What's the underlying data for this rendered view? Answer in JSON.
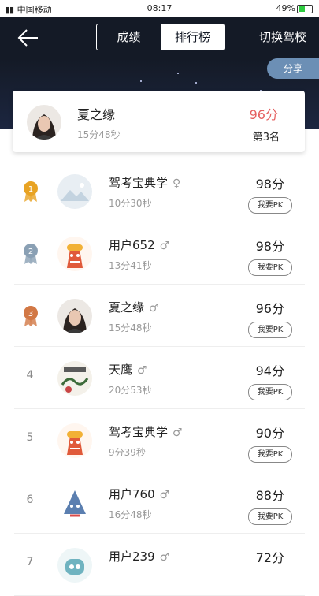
{
  "status_bar": {
    "left": "中国移动",
    "time": "08:17",
    "battery": "49%",
    "battery_level": 0.49
  },
  "header": {
    "tabs": [
      {
        "label": "成绩",
        "active": false
      },
      {
        "label": "排行榜",
        "active": true
      }
    ],
    "switch_label": "切换驾校"
  },
  "share_label": "分享",
  "me": {
    "name": "夏之缘",
    "time": "15分48秒",
    "score": "96分",
    "rank": "第3名"
  },
  "ranking": [
    {
      "rank": "1",
      "medal": "gold",
      "name": "驾考宝典学",
      "gender": "♀",
      "time": "10分30秒",
      "score": "98分",
      "pk": "我要PK",
      "avatar": "mountain"
    },
    {
      "rank": "2",
      "medal": "silver",
      "name": "用户652",
      "gender": "♂",
      "time": "13分41秒",
      "score": "98分",
      "pk": "我要PK",
      "avatar": "mascot"
    },
    {
      "rank": "3",
      "medal": "bronze",
      "name": "夏之缘",
      "gender": "♂",
      "time": "15分48秒",
      "score": "96分",
      "pk": "我要PK",
      "avatar": "person"
    },
    {
      "rank": "4",
      "medal": "",
      "name": "天鹰",
      "gender": "♂",
      "time": "20分53秒",
      "score": "94分",
      "pk": "我要PK",
      "avatar": "paint"
    },
    {
      "rank": "5",
      "medal": "",
      "name": "驾考宝典学",
      "gender": "♂",
      "time": "9分39秒",
      "score": "90分",
      "pk": "我要PK",
      "avatar": "mascot"
    },
    {
      "rank": "6",
      "medal": "",
      "name": "用户760",
      "gender": "♂",
      "time": "16分48秒",
      "score": "88分",
      "pk": "我要PK",
      "avatar": "cone"
    },
    {
      "rank": "7",
      "medal": "",
      "name": "用户239",
      "gender": "♂",
      "time": "",
      "score": "72分",
      "pk": "",
      "avatar": "robot"
    }
  ],
  "colors": {
    "header_bg": "#141a26",
    "score_highlight": "#e56060",
    "gold": "#e8a323",
    "silver": "#8aa0b4",
    "bronze": "#d27845"
  }
}
